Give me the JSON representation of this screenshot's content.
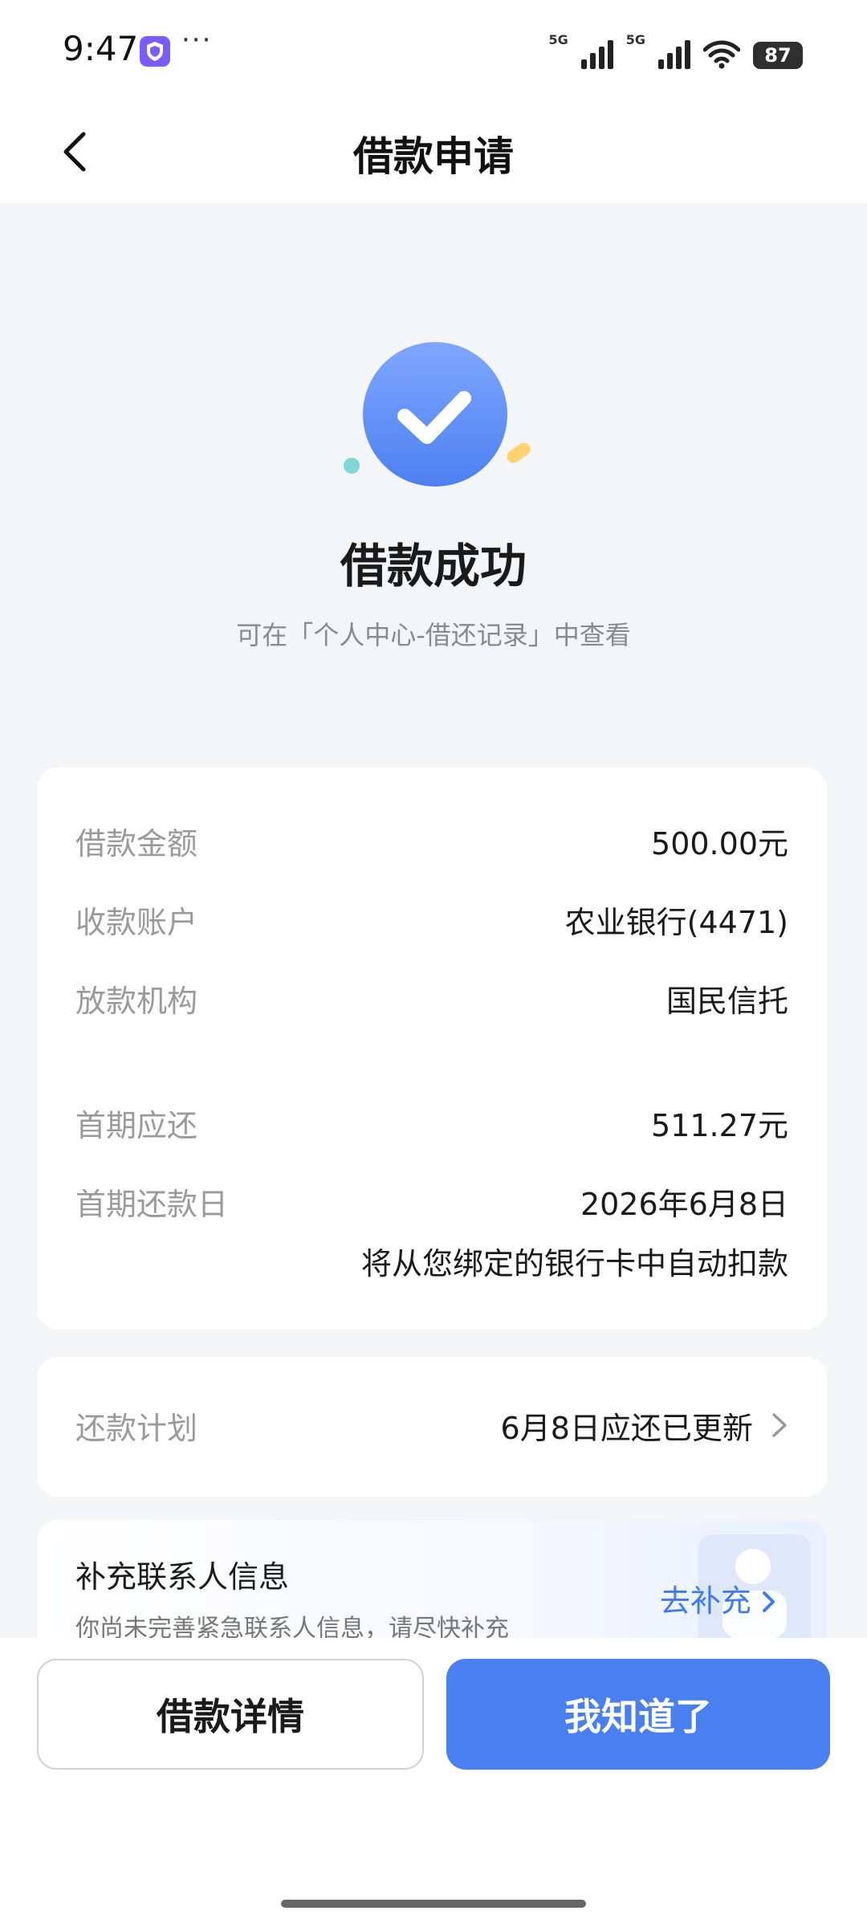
{
  "status_bar": {
    "time": "9:47",
    "dots": "···",
    "network_1": "5G",
    "network_2": "5G",
    "battery": "87"
  },
  "header": {
    "title": "借款申请"
  },
  "result": {
    "title": "借款成功",
    "subtitle": "可在「个人中心-借还记录」中查看"
  },
  "details": {
    "rows": [
      {
        "label": "借款金额",
        "value": "500.00元"
      },
      {
        "label": "收款账户",
        "value": "农业银行(4471)"
      },
      {
        "label": "放款机构",
        "value": "国民信托"
      },
      {
        "label": "首期应还",
        "value": "511.27元"
      },
      {
        "label": "首期还款日",
        "value": "2026年6月8日"
      }
    ],
    "note": "将从您绑定的银行卡中自动扣款"
  },
  "plan": {
    "label": "还款计划",
    "value": "6月8日应还已更新"
  },
  "contact": {
    "title": "补充联系人信息",
    "description": "你尚未完善紧急联系人信息，请尽快补充",
    "link": "去补充"
  },
  "actions": {
    "detail_label": "借款详情",
    "ok_label": "我知道了"
  },
  "colors": {
    "accent": "#4a7ff0",
    "link": "#3f7bf0",
    "background": "#f4f5f7"
  }
}
